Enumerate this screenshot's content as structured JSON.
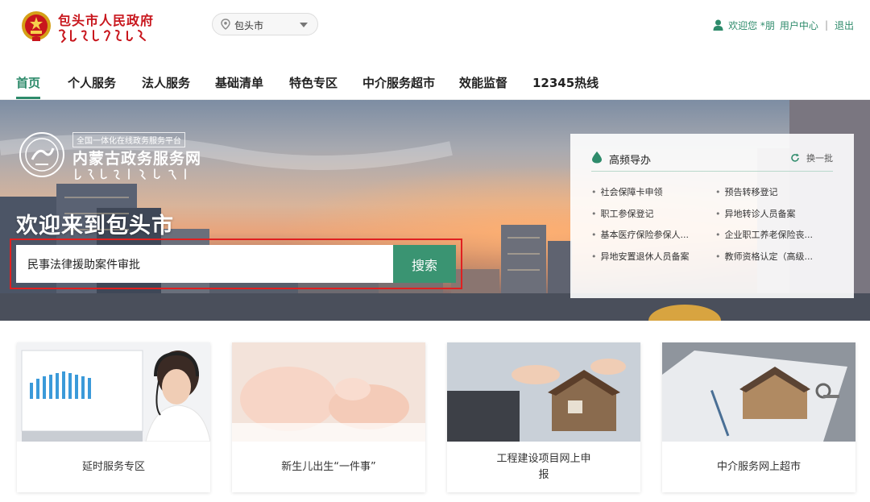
{
  "header": {
    "site_title": "包头市人民政府",
    "city_select": "包头市",
    "welcome": "欢迎您 *朋",
    "user_center": "用户中心",
    "separator": "|",
    "logout": "退出"
  },
  "nav": {
    "items": [
      "首页",
      "个人服务",
      "法人服务",
      "基础清单",
      "特色专区",
      "中介服务超市",
      "效能监督",
      "12345热线"
    ],
    "active_index": 0
  },
  "banner": {
    "portal_tag": "全国一体化在线政务服务平台",
    "portal_name": "内蒙古政务服务网",
    "welcome_title": "欢迎来到包头市",
    "search": {
      "value": "民事法律援助案件审批",
      "button": "搜索"
    },
    "hot_panel": {
      "title": "高频导办",
      "refresh": "换一批",
      "items": [
        "社会保障卡申领",
        "预告转移登记",
        "职工参保登记",
        "异地转诊人员备案",
        "基本医疗保险参保人...",
        "企业职工养老保险丧...",
        "异地安置退休人员备案",
        "教师资格认定（高级..."
      ]
    }
  },
  "cards": [
    {
      "label": "延时服务专区",
      "icon": "call-center-image"
    },
    {
      "label": "新生儿出生“一件事”",
      "icon": "newborn-image"
    },
    {
      "label": "工程建设项目网上申报",
      "icon": "construction-project-image"
    },
    {
      "label": "中介服务网上超市",
      "icon": "intermediary-market-image"
    }
  ],
  "colors": {
    "brand_green": "#2e8b6b",
    "search_button": "#3a9472",
    "title_red": "#c8161d",
    "highlight_outline": "#e02020"
  }
}
